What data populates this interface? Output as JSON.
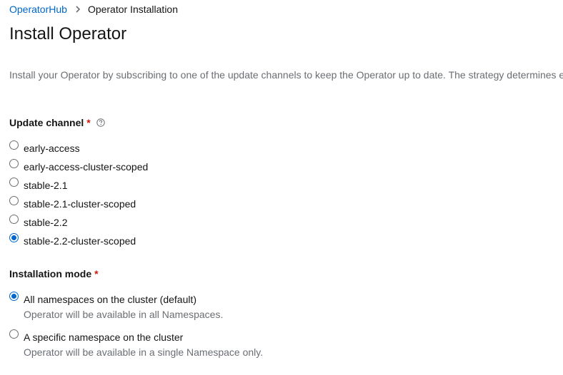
{
  "breadcrumb": {
    "link": "OperatorHub",
    "current": "Operator Installation"
  },
  "page": {
    "title": "Install Operator",
    "description": "Install your Operator by subscribing to one of the update channels to keep the Operator up to date. The strategy determines either manual or automatic updates."
  },
  "update_channel": {
    "label": "Update channel",
    "required_mark": "*",
    "options": [
      {
        "label": "early-access",
        "checked": false
      },
      {
        "label": "early-access-cluster-scoped",
        "checked": false
      },
      {
        "label": "stable-2.1",
        "checked": false
      },
      {
        "label": "stable-2.1-cluster-scoped",
        "checked": false
      },
      {
        "label": "stable-2.2",
        "checked": false
      },
      {
        "label": "stable-2.2-cluster-scoped",
        "checked": true
      }
    ]
  },
  "installation_mode": {
    "label": "Installation mode",
    "required_mark": "*",
    "options": [
      {
        "label": "All namespaces on the cluster (default)",
        "description": "Operator will be available in all Namespaces.",
        "checked": true
      },
      {
        "label": "A specific namespace on the cluster",
        "description": "Operator will be available in a single Namespace only.",
        "checked": false
      }
    ]
  },
  "colors": {
    "link": "#0066cc",
    "required": "#c9190b",
    "muted": "#6a6e73"
  }
}
